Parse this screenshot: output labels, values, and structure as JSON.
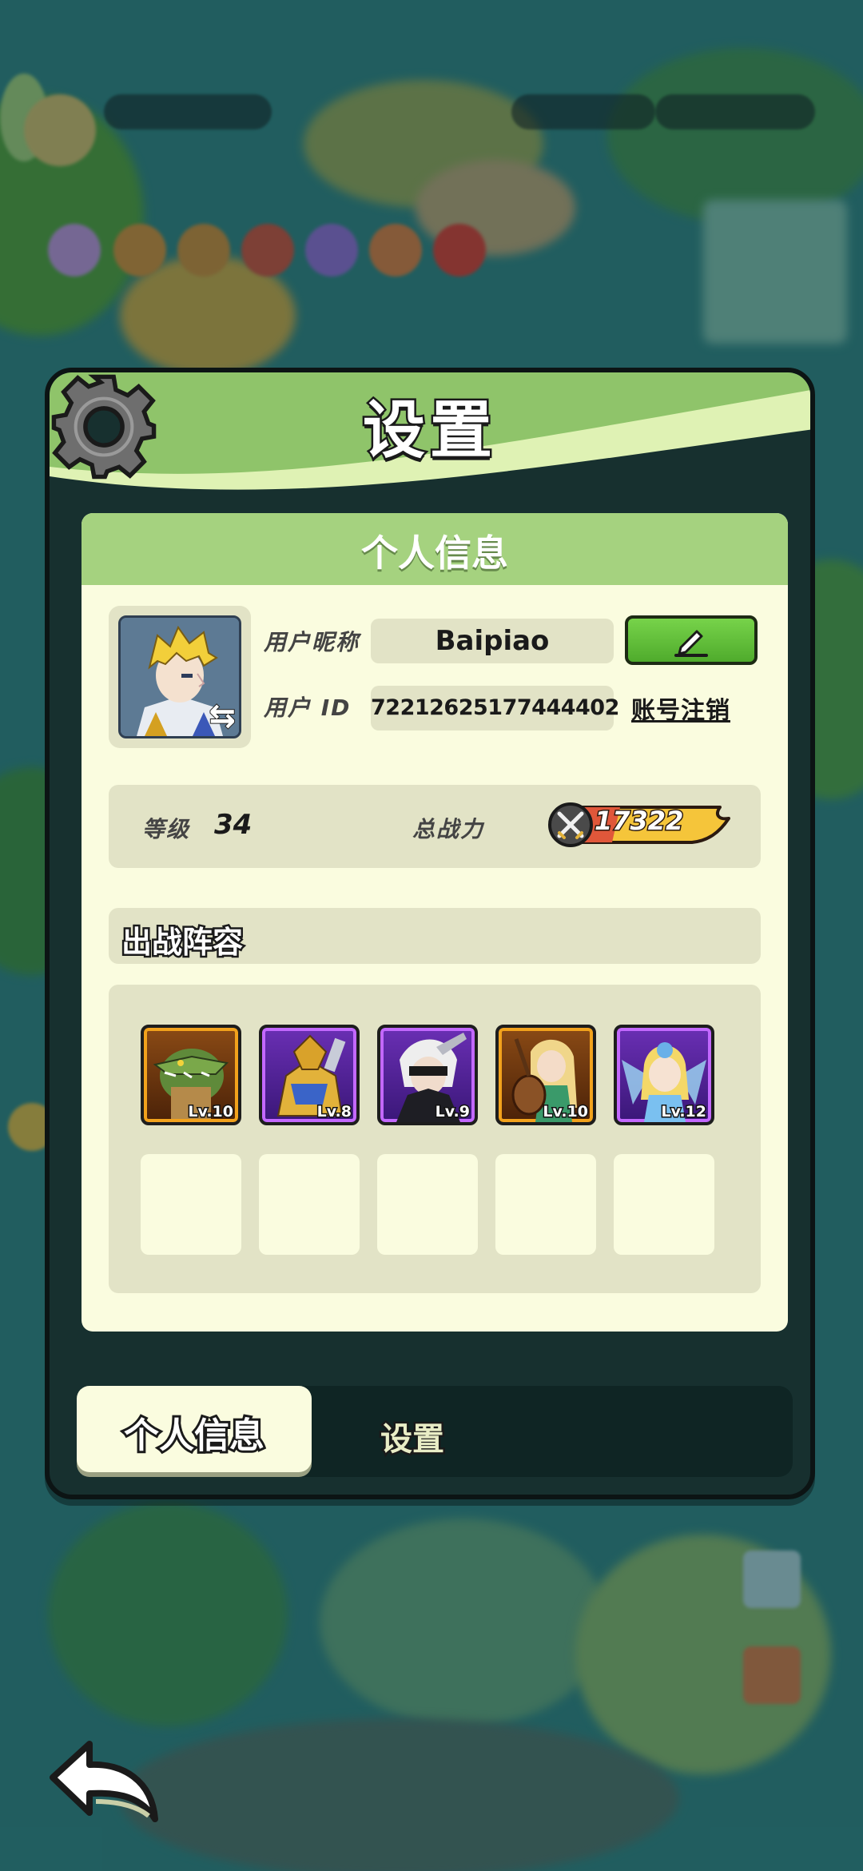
{
  "panel": {
    "title": "设置"
  },
  "profile": {
    "section_title": "个人信息",
    "nickname_label": "用户昵称",
    "nickname_value": "Baipiao",
    "id_label": "用户 ID",
    "id_value": "72212625177444402",
    "account_cancel_label": "账号注销",
    "edit_icon": "pencil-icon",
    "avatar_badge_icon": "swap-arrow-icon"
  },
  "stats": {
    "level_label": "等级",
    "level_value": "34",
    "power_label": "总战力",
    "power_value": "17322",
    "power_icon": "crossed-swords-icon"
  },
  "lineup": {
    "title": "出战阵容",
    "heroes": [
      {
        "level": "Lv.10",
        "rarity": "orange",
        "portrait": "crocodile-warrior"
      },
      {
        "level": "Lv.8",
        "rarity": "purple",
        "portrait": "gold-armored-knight"
      },
      {
        "level": "Lv.9",
        "rarity": "purple",
        "portrait": "white-haired-android"
      },
      {
        "level": "Lv.10",
        "rarity": "orange",
        "portrait": "lute-bard"
      },
      {
        "level": "Lv.12",
        "rarity": "purple",
        "portrait": "fairy-girl"
      }
    ],
    "empty_slots": 5
  },
  "tabs": [
    {
      "label": "个人信息",
      "active": true
    },
    {
      "label": "设置",
      "active": false
    }
  ],
  "colors": {
    "header_green": "#8fc46a",
    "card_bg": "#fafcdf",
    "pill_bg": "#e2e3c6",
    "edit_button": "#5fbf38",
    "power_gold": "#f5c53a",
    "rarity_orange": "#f2a21c",
    "rarity_purple": "#c368ff"
  }
}
